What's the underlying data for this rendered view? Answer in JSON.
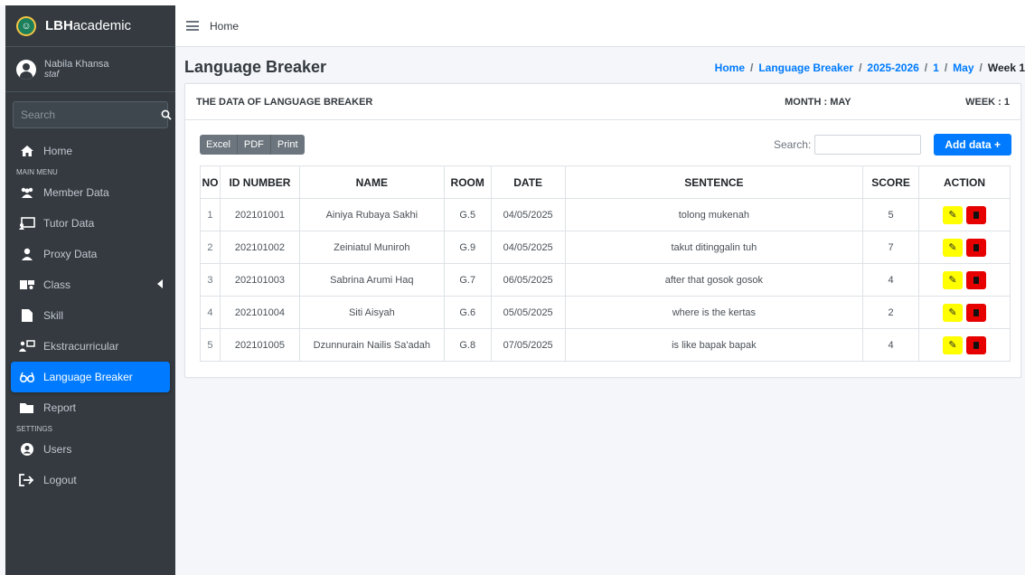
{
  "brand": {
    "bold": "LBH",
    "rest": "academic"
  },
  "user": {
    "name": "Nabila Khansa",
    "role": "staf"
  },
  "sidebar": {
    "search_placeholder": "Search",
    "items": [
      {
        "label": "Home",
        "icon": "home-icon"
      },
      {
        "header": "MAIN MENU"
      },
      {
        "label": "Member Data",
        "icon": "users-icon"
      },
      {
        "label": "Tutor Data",
        "icon": "chalkboard-icon"
      },
      {
        "label": "Proxy Data",
        "icon": "user-tie-icon"
      },
      {
        "label": "Class",
        "icon": "class-icon"
      },
      {
        "label": "Skill",
        "icon": "file-icon"
      },
      {
        "label": "Ekstracurricular",
        "icon": "sitemap-icon"
      },
      {
        "label": "Language Breaker",
        "icon": "glasses-icon"
      },
      {
        "label": "Report",
        "icon": "folder-icon"
      },
      {
        "header": "SETTINGS"
      },
      {
        "label": "Users",
        "icon": "user-circle-icon"
      },
      {
        "label": "Logout",
        "icon": "logout-icon"
      }
    ]
  },
  "topbar": {
    "home": "Home"
  },
  "page": {
    "title": "Language Breaker",
    "breadcrumb": [
      "Home",
      "Language Breaker",
      "2025-2026",
      "1",
      "May",
      "Week 1"
    ]
  },
  "card": {
    "title": "THE DATA OF LANGUAGE BREAKER",
    "month": "MONTH : MAY",
    "week": "WEEK : 1"
  },
  "toolbar": {
    "excel": "Excel",
    "pdf": "PDF",
    "print": "Print",
    "search_label": "Search:",
    "add": "Add data +"
  },
  "table": {
    "headers": [
      "NO",
      "ID NUMBER",
      "NAME",
      "ROOM",
      "DATE",
      "SENTENCE",
      "SCORE",
      "ACTION"
    ],
    "rows": [
      [
        "1",
        "202101001",
        "Ainiya Rubaya Sakhi",
        "G.5",
        "04/05/2025",
        "tolong mukenah",
        "5"
      ],
      [
        "2",
        "202101002",
        "Zeiniatul Muniroh",
        "G.9",
        "04/05/2025",
        "takut ditinggalin tuh",
        "7"
      ],
      [
        "3",
        "202101003",
        "Sabrina Arumi Haq",
        "G.7",
        "06/05/2025",
        "after that gosok gosok",
        "4"
      ],
      [
        "4",
        "202101004",
        "Siti Aisyah",
        "G.6",
        "05/05/2025",
        "where is the kertas",
        "2"
      ],
      [
        "5",
        "202101005",
        "Dzunnurain Nailis Sa'adah",
        "G.8",
        "07/05/2025",
        "is like bapak bapak",
        "4"
      ]
    ]
  },
  "colors": {
    "accent": "#007bff",
    "sidebar": "#343a40",
    "edit": "#ffff00",
    "delete": "#e60000"
  }
}
